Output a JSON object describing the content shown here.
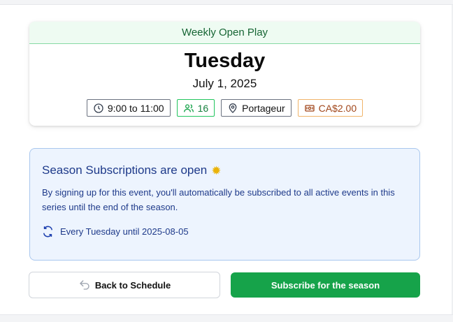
{
  "event": {
    "series_name": "Weekly Open Play",
    "day": "Tuesday",
    "date": "July 1, 2025",
    "time": "9:00 to 11:00",
    "attendees": "16",
    "location": "Portageur",
    "price": "CA$2.00"
  },
  "season": {
    "title": "Season Subscriptions are open",
    "title_emoji": "sun-icon",
    "description": "By signing up for this event, you'll automatically be subscribed to all active events in this series until the end of the season.",
    "repeat": "Every Tuesday until 2025-08-05"
  },
  "actions": {
    "back_label": "Back to Schedule",
    "subscribe_label": "Subscribe for the season"
  },
  "colors": {
    "header_bg": "#eefbf2",
    "header_text": "#166534",
    "subscribe_bg": "#16a34a",
    "info_bg": "#edf4fe",
    "info_text": "#1e3a8a",
    "price_border": "#f0b46a"
  }
}
